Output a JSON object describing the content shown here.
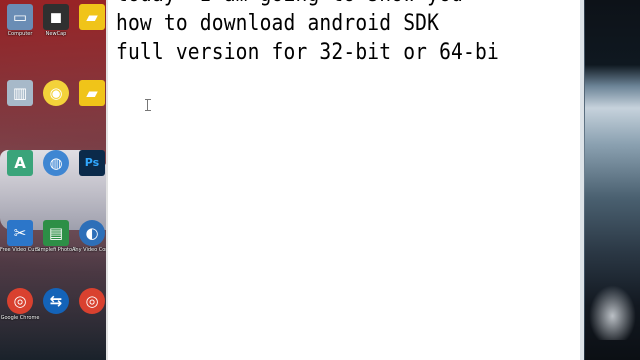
{
  "desktop": {
    "icons": [
      {
        "label": "Computer",
        "icon": "computer-icon",
        "color": "#6a8db5",
        "glyph": "▭"
      },
      {
        "label": "NewCap",
        "icon": "camera-icon",
        "color": "#303030",
        "glyph": "◼"
      },
      {
        "label": "",
        "icon": "folder-icon",
        "color": "#f0c419",
        "glyph": "▰"
      },
      {
        "label": "",
        "icon": "recycle-bin-icon",
        "color": "#a7b9c9",
        "glyph": "▥"
      },
      {
        "label": "",
        "icon": "disc-icon",
        "color": "#f3d23a",
        "glyph": "◉"
      },
      {
        "label": "",
        "icon": "folder-icon",
        "color": "#f0c419",
        "glyph": "▰"
      },
      {
        "label": "",
        "icon": "app-a-icon",
        "color": "#3aa47a",
        "glyph": "A"
      },
      {
        "label": "",
        "icon": "globe-icon",
        "color": "#3f86d2",
        "glyph": "◍"
      },
      {
        "label": "",
        "icon": "photoshop-icon",
        "color": "#0b2a4a",
        "glyph": "Ps"
      },
      {
        "label": "Free Video Cutter Joiner",
        "icon": "video-cutter-icon",
        "color": "#2c76c9",
        "glyph": "✂"
      },
      {
        "label": "Simplefi Photo Sc",
        "icon": "photo-icon",
        "color": "#2d8f46",
        "glyph": "▤"
      },
      {
        "label": "Any Video Converter",
        "icon": "video-converter-icon",
        "color": "#2d6fb8",
        "glyph": "◐"
      },
      {
        "label": "Google Chrome",
        "icon": "chrome-icon",
        "color": "#d9412f",
        "glyph": "◎"
      },
      {
        "label": "",
        "icon": "teamviewer-icon",
        "color": "#1463b8",
        "glyph": "⇆"
      },
      {
        "label": "",
        "icon": "chrome-icon",
        "color": "#d9412f",
        "glyph": "◎"
      }
    ]
  },
  "editor": {
    "text": "today  I am going to show you\nhow to download android SDK\nfull version for 32-bit or 64-bi"
  }
}
